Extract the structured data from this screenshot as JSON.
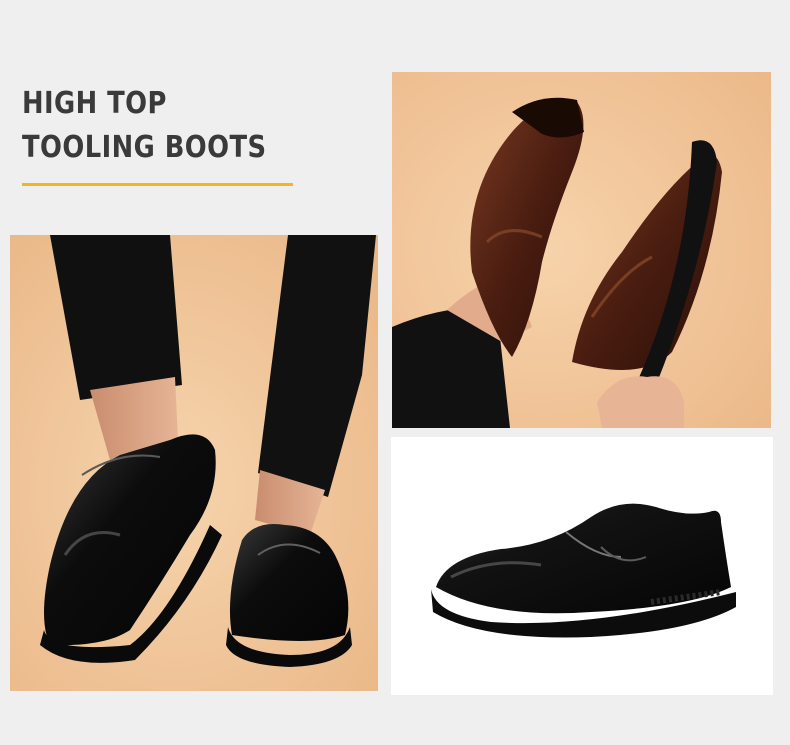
{
  "headline": {
    "line1": "HIGH TOP",
    "line2": "TOOLING BOOTS"
  },
  "colors": {
    "accent_underline": "#f3b61f",
    "page_background": "#efefef",
    "photo_background": "#f1c597",
    "headline_text": "#3a3a3a"
  },
  "photos": [
    {
      "name": "photo-worn-black-loafers"
    },
    {
      "name": "photo-brown-loafer-in-hand"
    },
    {
      "name": "photo-black-loafer-product"
    }
  ]
}
